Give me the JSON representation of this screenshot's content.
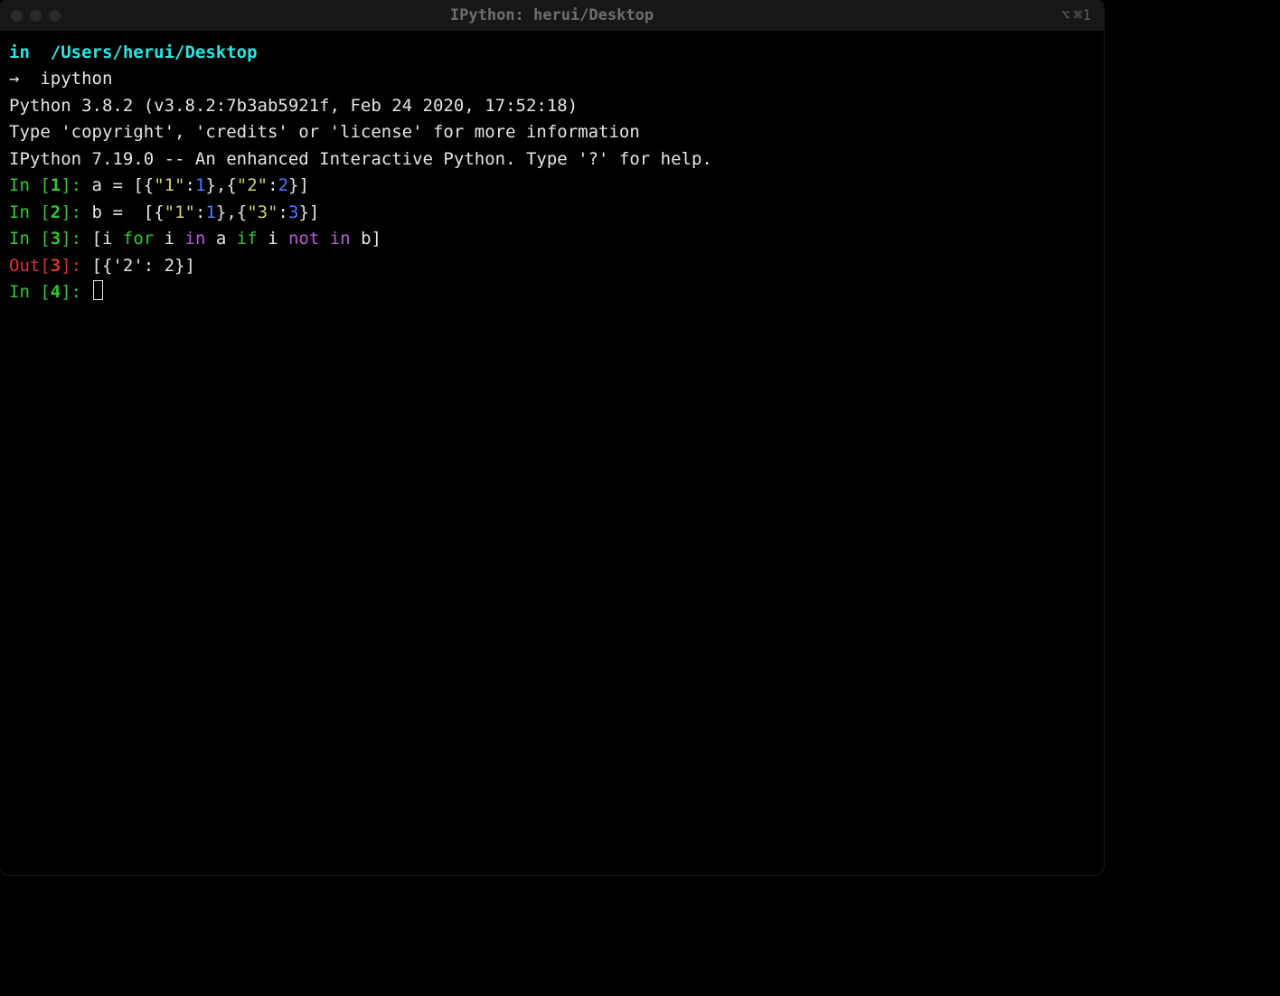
{
  "titlebar": {
    "title": "IPython: herui/Desktop",
    "shortcut": "⌘1",
    "shortcut_icon": "⌥"
  },
  "shell": {
    "prompt_user": "in",
    "prompt_path": "/Users/herui/Desktop",
    "arrow": "→",
    "command": "ipython"
  },
  "banner": {
    "line1": "Python 3.8.2 (v3.8.2:7b3ab5921f, Feb 24 2020, 17:52:18)",
    "line2": "Type 'copyright', 'credits' or 'license' for more information",
    "line3": "IPython 7.19.0 -- An enhanced Interactive Python. Type '?' for help."
  },
  "cells": [
    {
      "in_label": "In [",
      "n": "1",
      "in_close": "]: ",
      "tokens": [
        {
          "t": "a ",
          "c": "white"
        },
        {
          "t": "=",
          "c": "white"
        },
        {
          "t": " [{",
          "c": "white"
        },
        {
          "t": "\"1\"",
          "c": "yellow"
        },
        {
          "t": ":",
          "c": "white"
        },
        {
          "t": "1",
          "c": "blue"
        },
        {
          "t": "},{",
          "c": "white"
        },
        {
          "t": "\"2\"",
          "c": "yellow"
        },
        {
          "t": ":",
          "c": "white"
        },
        {
          "t": "2",
          "c": "blue"
        },
        {
          "t": "}]",
          "c": "white"
        }
      ]
    },
    {
      "in_label": "In [",
      "n": "2",
      "in_close": "]: ",
      "tokens": [
        {
          "t": "b ",
          "c": "white"
        },
        {
          "t": "=",
          "c": "white"
        },
        {
          "t": "  [{",
          "c": "white"
        },
        {
          "t": "\"1\"",
          "c": "yellow"
        },
        {
          "t": ":",
          "c": "white"
        },
        {
          "t": "1",
          "c": "blue"
        },
        {
          "t": "},{",
          "c": "white"
        },
        {
          "t": "\"3\"",
          "c": "yellow"
        },
        {
          "t": ":",
          "c": "white"
        },
        {
          "t": "3",
          "c": "blue"
        },
        {
          "t": "}]",
          "c": "white"
        }
      ]
    },
    {
      "in_label": "In [",
      "n": "3",
      "in_close": "]: ",
      "tokens": [
        {
          "t": "[i ",
          "c": "white"
        },
        {
          "t": "for",
          "c": "green"
        },
        {
          "t": " i ",
          "c": "white"
        },
        {
          "t": "in",
          "c": "purple"
        },
        {
          "t": " a ",
          "c": "white"
        },
        {
          "t": "if",
          "c": "green"
        },
        {
          "t": " i ",
          "c": "white"
        },
        {
          "t": "not",
          "c": "purple"
        },
        {
          "t": " ",
          "c": "white"
        },
        {
          "t": "in",
          "c": "purple"
        },
        {
          "t": " b]",
          "c": "white"
        }
      ],
      "out_label": "Out[",
      "out_close": "]: ",
      "output": "[{'2': 2}]"
    },
    {
      "in_label": "In [",
      "n": "4",
      "in_close": "]: ",
      "tokens": [],
      "cursor": true
    }
  ]
}
